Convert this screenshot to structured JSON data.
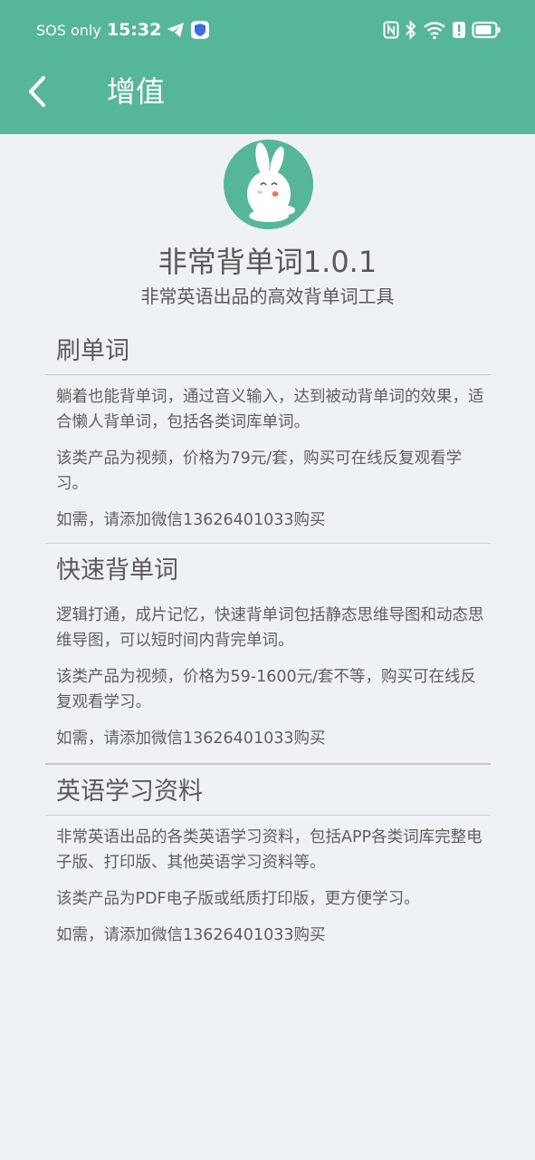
{
  "status_bar": {
    "carrier": "SOS only",
    "time": "15:32",
    "icons": [
      "telegram-icon",
      "shield-icon",
      "nfc-icon",
      "bluetooth-icon",
      "wifi-icon",
      "alert-icon",
      "battery-icon"
    ]
  },
  "navbar": {
    "back_icon": "chevron-left-icon",
    "title": "增值"
  },
  "app": {
    "title": "非常背单词1.0.1",
    "subtitle": "非常英语出品的高效背单词工具"
  },
  "sections": [
    {
      "title": "刷单词",
      "paragraphs": [
        "躺着也能背单词，通过音义输入，达到被动背单词的效果，适合懒人背单词，包括各类词库单词。",
        "该类产品为视频，价格为79元/套，购买可在线反复观看学习。",
        "如需，请添加微信13626401033购买"
      ]
    },
    {
      "title": "快速背单词",
      "paragraphs": [
        "逻辑打通，成片记忆，快速背单词包括静态思维导图和动态思维导图，可以短时间内背完单词。",
        "该类产品为视频，价格为59-1600元/套不等，购买可在线反复观看学习。",
        "如需，请添加微信13626401033购买"
      ]
    },
    {
      "title": "英语学习资料",
      "paragraphs": [
        "非常英语出品的各类英语学习资料，包括APP各类词库完整电子版、打印版、其他英语学习资料等。",
        "该类产品为PDF电子版或纸质打印版，更方便学习。",
        "如需，请添加微信13626401033购买"
      ]
    }
  ],
  "colors": {
    "header": "#56b699",
    "background": "#eef2f5",
    "text": "#5f5f5f"
  }
}
